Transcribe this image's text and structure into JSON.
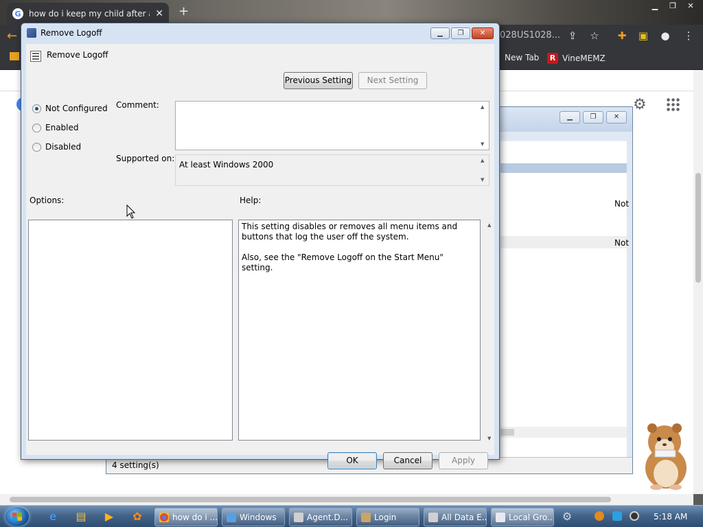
{
  "browser": {
    "tab_title": "how do i keep my child after abu",
    "url_tail": "028US1028...",
    "bookmarks": [
      {
        "label": "New Tab"
      },
      {
        "label": "VineMEMZ",
        "icon_letter": "R"
      }
    ]
  },
  "background_window": {
    "rows": [
      "Not",
      "Not"
    ],
    "status": "4 setting(s)"
  },
  "dialog": {
    "title": "Remove Logoff",
    "policy_name": "Remove Logoff",
    "prev_label": "Previous Setting",
    "next_label": "Next Setting",
    "radios": [
      {
        "label": "Not Configured",
        "checked": true
      },
      {
        "label": "Enabled",
        "checked": false
      },
      {
        "label": "Disabled",
        "checked": false
      }
    ],
    "comment_label": "Comment:",
    "comment_value": "",
    "supported_label": "Supported on:",
    "supported_value": "At least Windows 2000",
    "options_label": "Options:",
    "help_label": "Help:",
    "help_text": "This setting disables or removes all menu items and buttons that log the user off the system.\n\nAlso, see the \"Remove Logoff on the Start Menu\" setting.",
    "ok_label": "OK",
    "cancel_label": "Cancel",
    "apply_label": "Apply"
  },
  "taskbar": {
    "tasks": [
      {
        "label": "how do i ..."
      },
      {
        "label": "Windows"
      },
      {
        "label": "Agent.D..."
      },
      {
        "label": "Login"
      },
      {
        "label": "All Data E..."
      },
      {
        "label": "Local Gro..."
      }
    ],
    "clock": "5:18 AM"
  },
  "colors": {
    "dialog_frame": "#d6e3f3",
    "taskbar": "#44648a",
    "chrome_dark": "#35363a"
  }
}
